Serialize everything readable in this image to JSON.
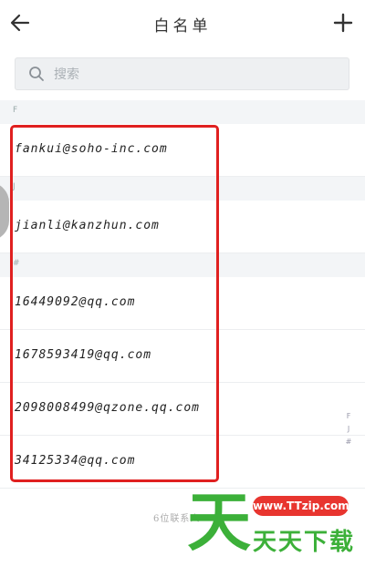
{
  "header": {
    "title": "白名单",
    "back_icon": "arrow-left-icon",
    "add_icon": "plus-icon"
  },
  "search": {
    "placeholder": "搜索",
    "icon": "search-icon"
  },
  "sections": [
    {
      "letter": "F",
      "items": [
        "fankui@soho-inc.com"
      ]
    },
    {
      "letter": "J",
      "items": [
        "jianli@kanzhun.com"
      ]
    },
    {
      "letter": "#",
      "items": [
        "16449092@qq.com",
        "1678593419@qq.com",
        "2098008499@qzone.qq.com",
        "34125334@qq.com"
      ]
    }
  ],
  "index_bar": [
    "F",
    "J",
    "#"
  ],
  "footer": {
    "count_text": "6位联系人"
  },
  "watermark": {
    "big_char": "天",
    "badge": "www.TTzip.com",
    "text": "天天下载"
  },
  "colors": {
    "highlight": "#e02020",
    "watermark_green": "#3cb039",
    "watermark_red": "#e8352f"
  }
}
